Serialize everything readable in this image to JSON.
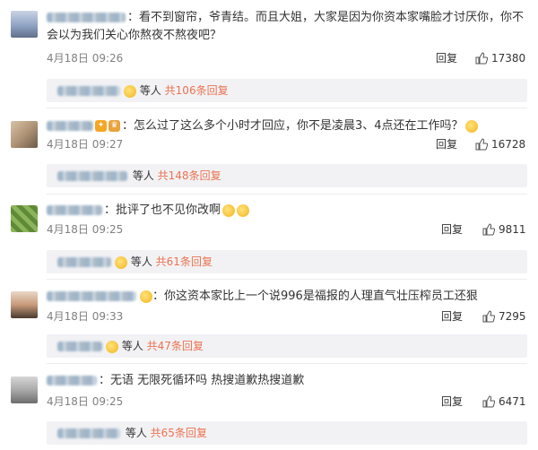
{
  "comments": [
    {
      "text": "：看不到窗帘，爷青结。而且大姐，大家是因为你资本家嘴脸才讨厌你，你不会以为我们关心你熬夜不熬夜吧？",
      "date": "4月18日 09:26",
      "reply_label": "回复",
      "likes": "17380",
      "sub_people": "等人",
      "sub_count": "共106条回复",
      "avatar_color": "#8fa3c4"
    },
    {
      "text": "：怎么过了这么多个小时才回应，你不是凌晨3、4点还在工作吗？",
      "date": "4月18日 09:27",
      "reply_label": "回复",
      "likes": "16728",
      "sub_people": "等人",
      "sub_count": "共148条回复",
      "avatar_color": "#b09478"
    },
    {
      "text": "：批评了也不见你改啊",
      "date": "4月18日 09:25",
      "reply_label": "回复",
      "likes": "9811",
      "sub_people": "等人",
      "sub_count": "共61条回复",
      "avatar_color": "#6f9a4a"
    },
    {
      "text": "：你这资本家比上一个说996是福报的人理直气壮压榨员工还狠",
      "date": "4月18日 09:33",
      "reply_label": "回复",
      "likes": "7295",
      "sub_people": "等人",
      "sub_count": "共47条回复",
      "avatar_color": "#c89a7a"
    },
    {
      "text": "：无语  无限死循环吗 热搜道歉热搜道歉",
      "date": "4月18日 09:25",
      "reply_label": "回复",
      "likes": "6471",
      "sub_people": "等人",
      "sub_count": "共65条回复",
      "avatar_color": "#a9a9a9"
    }
  ]
}
